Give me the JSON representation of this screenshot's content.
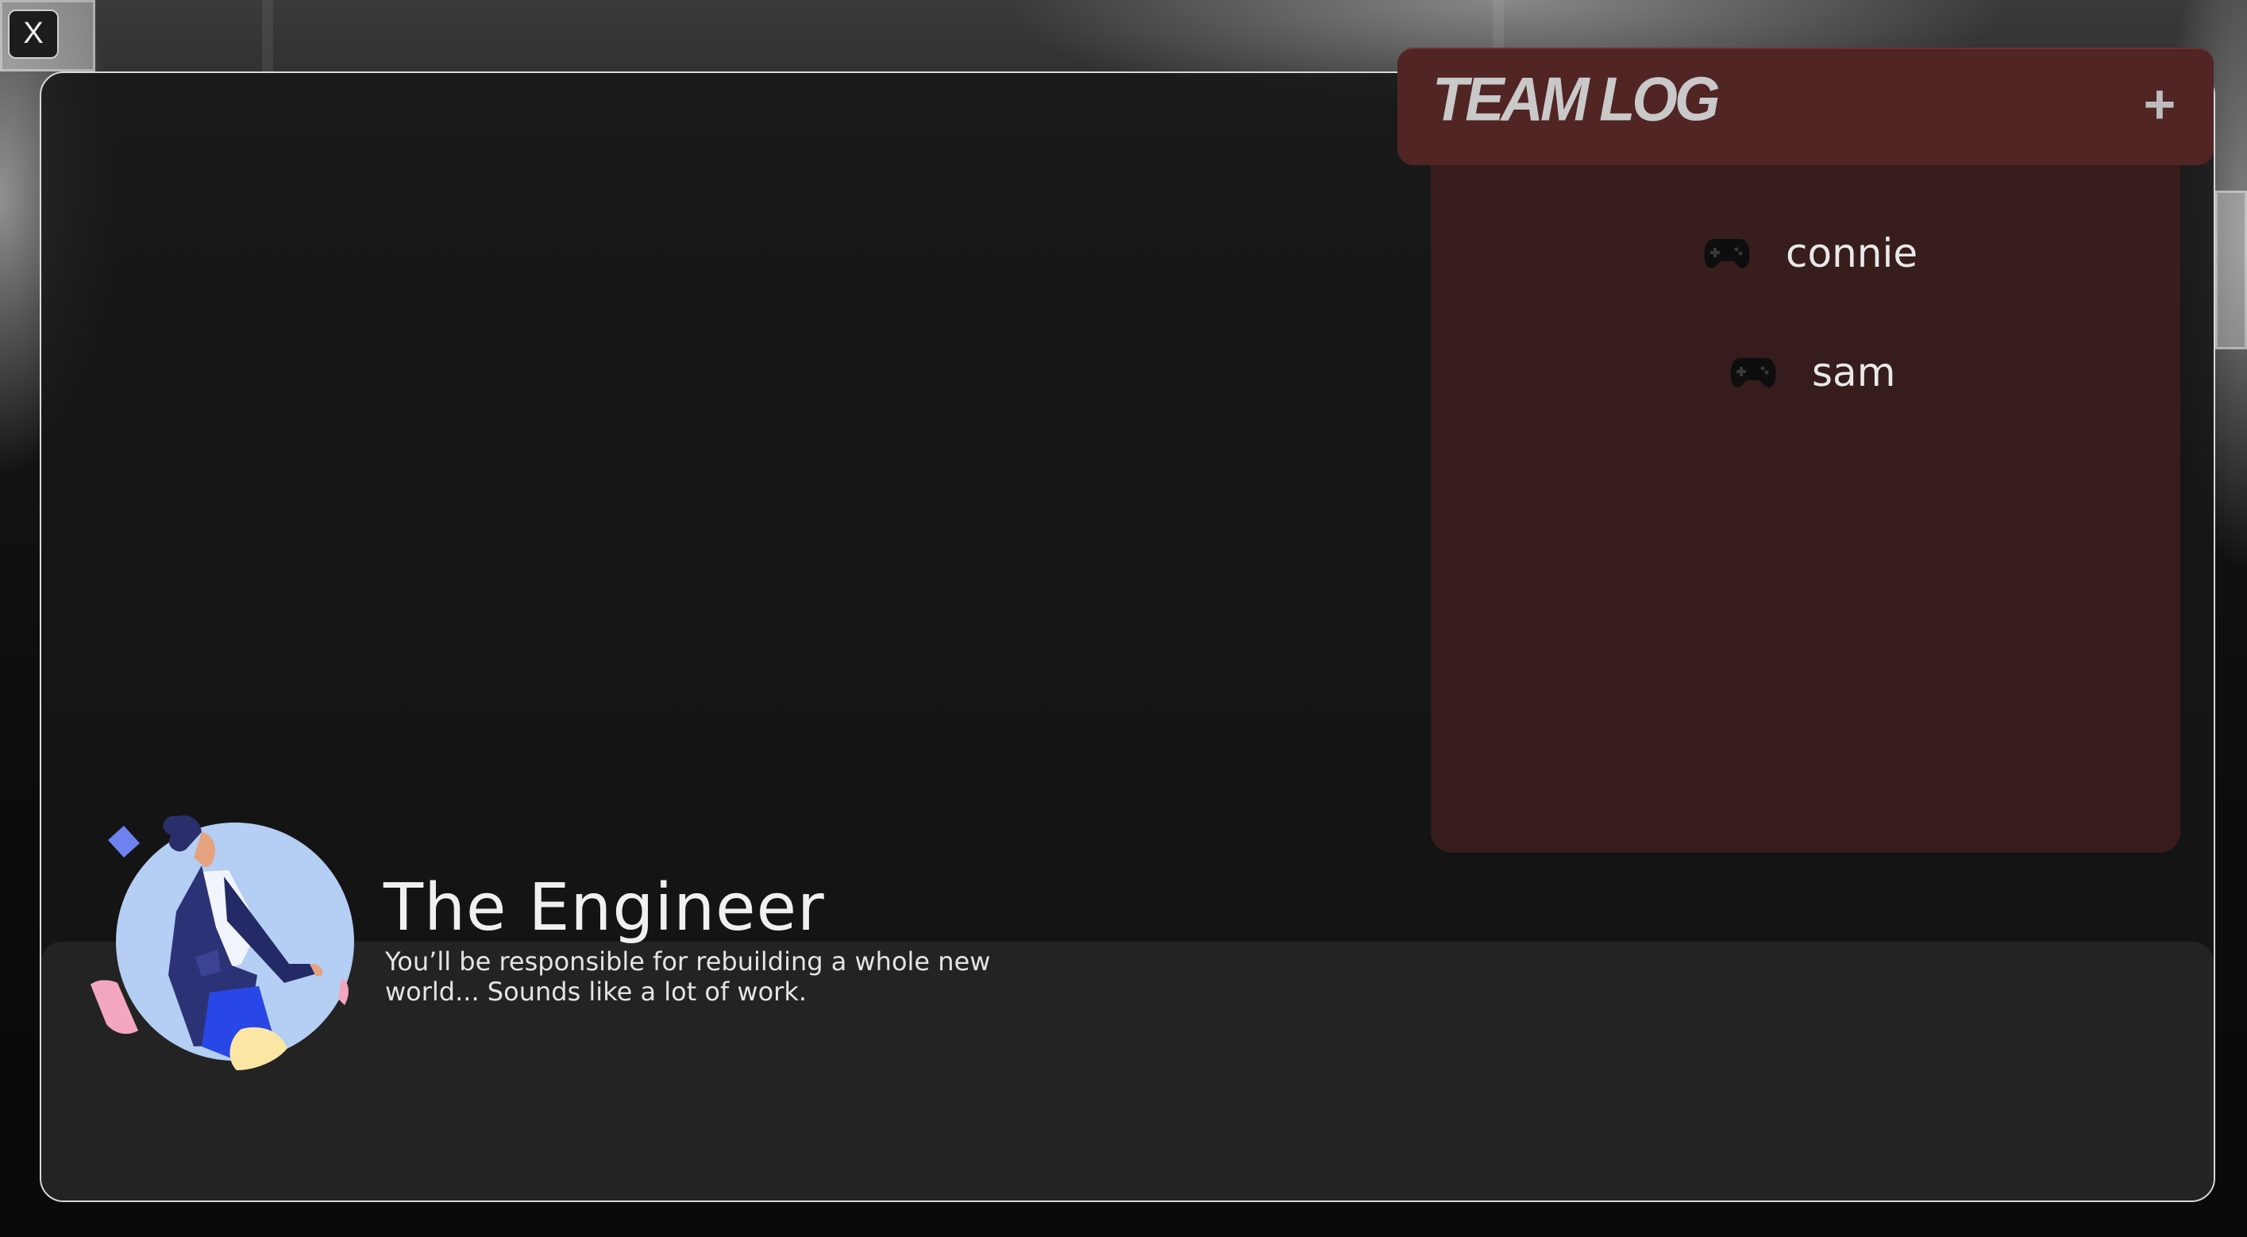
{
  "close_button": {
    "label": "X"
  },
  "team_log": {
    "title": "TEAM LOG",
    "add_label": "+",
    "players": [
      {
        "name": "connie",
        "icon": "gamepad-icon"
      },
      {
        "name": "sam",
        "icon": "gamepad-icon"
      }
    ]
  },
  "role": {
    "title": "The Engineer",
    "description": "You’ll be responsible for rebuilding a whole new world... Sounds like a lot of work.",
    "avatar": "engineer-avatar"
  },
  "colors": {
    "team_log_header": "#502524",
    "team_log_body": "#3f1e1e",
    "panel_border": "#d9d9d9",
    "avatar_circle": "#b4cef4"
  }
}
